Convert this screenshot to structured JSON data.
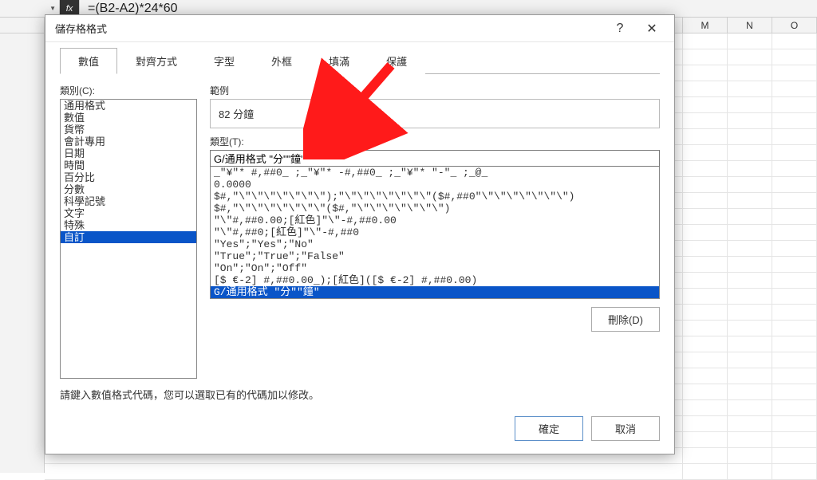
{
  "formula_bar": {
    "fx_label": "fx",
    "formula": "=(B2-A2)*24*60"
  },
  "columns_right": [
    "M",
    "N",
    "O"
  ],
  "dialog": {
    "title": "儲存格格式",
    "help_icon": "?",
    "close_icon": "✕",
    "tabs": [
      "數值",
      "對齊方式",
      "字型",
      "外框",
      "填滿",
      "保護"
    ],
    "active_tab_index": 0,
    "category_label": "類別(C):",
    "categories": [
      "通用格式",
      "數值",
      "貨幣",
      "會計專用",
      "日期",
      "時間",
      "百分比",
      "分數",
      "科學記號",
      "文字",
      "特殊",
      "自訂"
    ],
    "selected_category_index": 11,
    "sample_label": "範例",
    "sample_value": "82 分鐘",
    "type_label": "類型(T):",
    "type_value": "G/通用格式 \"分\"\"鐘\"",
    "formats": [
      "_\"¥\"* #,##0_ ;_\"¥\"* -#,##0_ ;_\"¥\"* \"-\"_ ;_@_",
      "0.0000",
      "$#,\"\\\"\\\"\\\"\\\"\\\"\\\"\\\");\"\\\"\\\"\\\"\\\"\\\"\\\"\\\"($#,##0\"\\\"\\\"\\\"\\\"\\\"\\\"\\\")",
      "$#,\"\\\"\\\"\\\"\\\"\\\"\\\"\\\"($#,\"\\\"\\\"\\\"\\\"\\\"\\\"\\\")",
      "\"\\\"#,##0.00;[紅色]\"\\\"-#,##0.00",
      "\"\\\"#,##0;[紅色]\"\\\"-#,##0",
      "\"Yes\";\"Yes\";\"No\"",
      "\"True\";\"True\";\"False\"",
      "\"On\";\"On\";\"Off\"",
      "[$ €-2] #,##0.00_);[紅色]([$ €-2] #,##0.00)",
      "G/通用格式 \"分\"\"鐘\""
    ],
    "selected_format_index": 10,
    "delete_button": "刪除(D)",
    "hint": "請鍵入數值格式代碼，您可以選取已有的代碼加以修改。",
    "ok_button": "確定",
    "cancel_button": "取消"
  }
}
